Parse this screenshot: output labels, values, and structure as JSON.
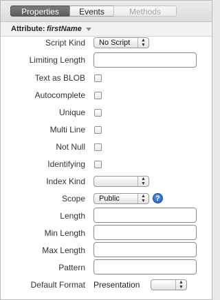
{
  "tabs": {
    "properties": "Properties",
    "events": "Events",
    "methods": "Methods"
  },
  "attribute_header": {
    "label": "Attribute:",
    "name": "firstName"
  },
  "form": {
    "script_kind": {
      "label": "Script Kind",
      "value": "No Script"
    },
    "limiting_length": {
      "label": "Limiting Length",
      "value": ""
    },
    "text_as_blob": {
      "label": "Text as BLOB",
      "checked": false
    },
    "autocomplete": {
      "label": "Autocomplete",
      "checked": false
    },
    "unique": {
      "label": "Unique",
      "checked": false
    },
    "multi_line": {
      "label": "Multi Line",
      "checked": false
    },
    "not_null": {
      "label": "Not Null",
      "checked": false
    },
    "identifying": {
      "label": "Identifying",
      "checked": false
    },
    "index_kind": {
      "label": "Index Kind",
      "value": ""
    },
    "scope": {
      "label": "Scope",
      "value": "Public"
    },
    "length": {
      "label": "Length",
      "value": ""
    },
    "min_length": {
      "label": "Min Length",
      "value": ""
    },
    "max_length": {
      "label": "Max Length",
      "value": ""
    },
    "pattern": {
      "label": "Pattern",
      "value": ""
    },
    "default_format": {
      "label": "Default Format",
      "text": "Presentation",
      "value": ""
    }
  },
  "help_icon_glyph": "?",
  "colors": {
    "active_tab": "#6b6b6b",
    "help_blue": "#1f5fb8"
  }
}
